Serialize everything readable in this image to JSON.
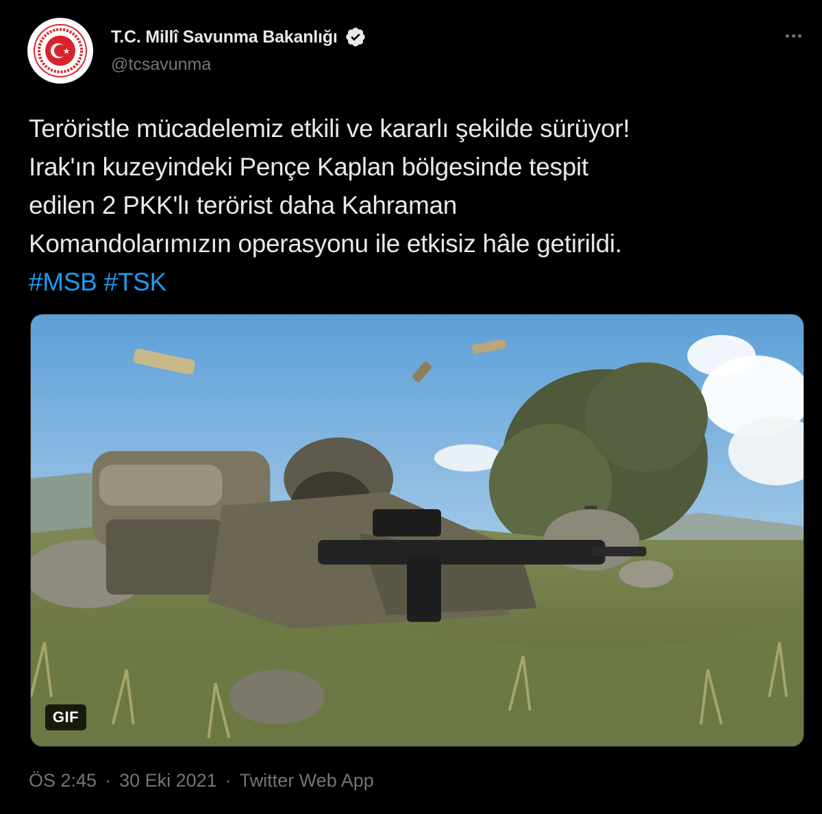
{
  "author": {
    "display_name": "T.C. Millî Savunma Bakanlığı",
    "handle": "@tcsavunma",
    "verified_icon": "verified-badge-icon",
    "avatar_icon": "ministry-emblem-icon"
  },
  "tweet": {
    "lines": [
      "Teröristle mücadelemiz etkili ve kararlı şekilde sürüyor!",
      "Irak'ın kuzeyindeki Pençe Kaplan bölgesinde tespit",
      "edilen 2 PKK'lı terörist daha Kahraman",
      "Komandolarımızın operasyonu ile etkisiz hâle getirildi."
    ],
    "hashtags": [
      "#MSB",
      "#TSK"
    ]
  },
  "media": {
    "badge": "GIF"
  },
  "meta": {
    "time": "ÖS 2:45",
    "separator1": "·",
    "date": "30 Eki 2021",
    "separator2": "·",
    "source": "Twitter Web App"
  },
  "colors": {
    "background": "#000000",
    "text": "#e7e9ea",
    "secondary": "#71767b",
    "accent": "#1d9bf0",
    "emblem_red": "#d8232a"
  }
}
